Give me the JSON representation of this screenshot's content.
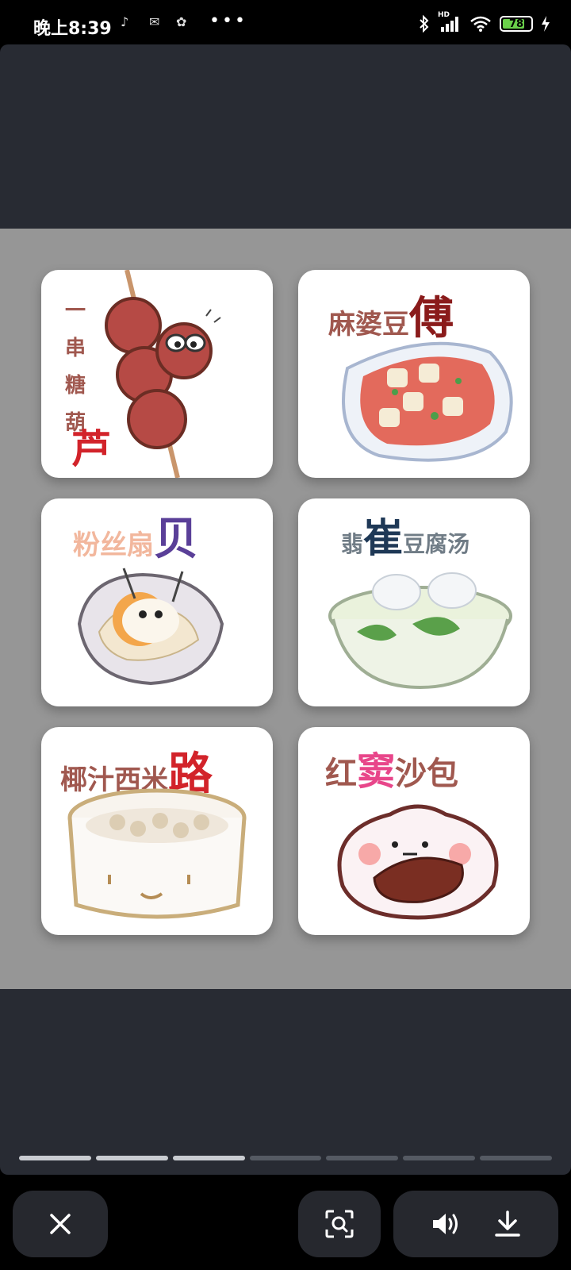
{
  "status_bar": {
    "time": "晚上8:39",
    "notifications": [
      "tiktok-icon",
      "mail-icon",
      "app-icon"
    ],
    "more": "•••",
    "battery": 78,
    "network": "HD"
  },
  "gallery": {
    "items": [
      {
        "parts": [
          "一串糖葫",
          "芦"
        ],
        "accent": "#d2232a",
        "icon": "candied-haws-icon"
      },
      {
        "parts": [
          "麻婆豆",
          "傅"
        ],
        "accent": "#8a1b1b",
        "icon": "mapo-tofu-icon"
      },
      {
        "parts": [
          "粉丝扇",
          "贝"
        ],
        "accent": "#5a3f98",
        "icon": "scallop-icon"
      },
      {
        "parts": [
          "翡",
          "崔",
          "豆腐汤"
        ],
        "accent": "#1e3856",
        "icon": "tofu-soup-icon"
      },
      {
        "parts": [
          "椰汁西米",
          "路"
        ],
        "accent": "#d2232a",
        "icon": "sago-icon"
      },
      {
        "parts": [
          "红",
          "窦",
          "沙包"
        ],
        "accent": "#e8468a",
        "icon": "red-bean-bun-icon"
      }
    ]
  },
  "pager": {
    "total": 7,
    "current": 3
  },
  "toolbar": {
    "close": "close-icon",
    "scan": "scan-icon",
    "volume": "volume-icon",
    "download": "download-icon"
  }
}
